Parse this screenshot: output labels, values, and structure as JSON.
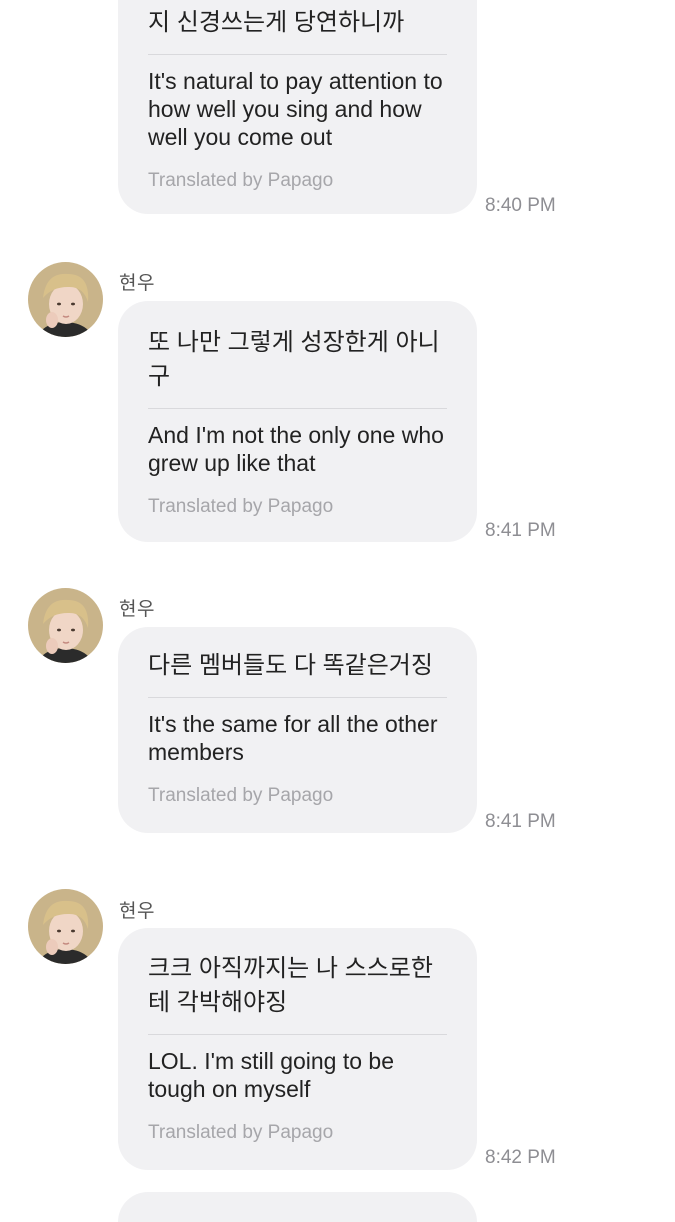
{
  "messages": [
    {
      "sender": "",
      "original": "지 신경쓰는게 당연하니까",
      "translation": "It's natural to pay attention to how well you sing and how well you come out",
      "translated_by": "Translated by Papago",
      "time": "8:40 PM"
    },
    {
      "sender": "현우",
      "original": "또 나만 그렇게 성장한게 아니구",
      "translation": "And I'm not the only one who grew up like that",
      "translated_by": "Translated by Papago",
      "time": "8:41 PM"
    },
    {
      "sender": "현우",
      "original": "다른 멤버들도 다 똑같은거징",
      "translation": "It's the same for all the other members",
      "translated_by": "Translated by Papago",
      "time": "8:41 PM"
    },
    {
      "sender": "현우",
      "original": "크크 아직까지는 나 스스로한테 각박해야징",
      "translation": "LOL. I'm still going to be tough on myself",
      "translated_by": "Translated by Papago",
      "time": "8:42 PM"
    }
  ]
}
